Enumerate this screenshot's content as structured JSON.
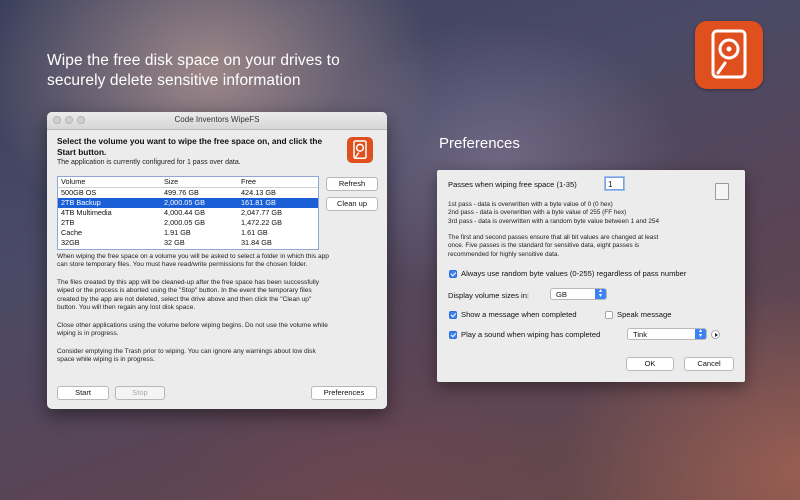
{
  "headline": {
    "line1": "Wipe the free disk space on your drives to",
    "line2": "securely delete sensitive information"
  },
  "app_icon": {
    "icon": "hard-drive-eraser-icon",
    "color": "#e0501f"
  },
  "window": {
    "title": "Code Inventors WipeFS",
    "instruction_line1": "Select the volume you want to wipe the free space on, and click the",
    "instruction_line2": "Start button.",
    "config_text": "The application is currently configured for 1 pass over data.",
    "table": {
      "headers": {
        "volume": "Volume",
        "size": "Size",
        "free": "Free"
      },
      "rows": [
        {
          "volume": "500GB OS",
          "size": "499.76 GB",
          "free": "424.13 GB"
        },
        {
          "volume": "2TB Backup",
          "size": "2,000.05 GB",
          "free": "161.81 GB"
        },
        {
          "volume": "4TB Multimedia",
          "size": "4,000.44 GB",
          "free": "2,047.77 GB"
        },
        {
          "volume": "2TB",
          "size": "2,000.05 GB",
          "free": "1,472.22 GB"
        },
        {
          "volume": "Cache",
          "size": "1.91 GB",
          "free": "1.61 GB"
        },
        {
          "volume": "32GB",
          "size": "32 GB",
          "free": "31.84 GB"
        }
      ],
      "selected_index": 1,
      "selection_color": "#1a5fd6"
    },
    "buttons": {
      "refresh": "Refresh",
      "cleanup": "Clean up",
      "start": "Start",
      "stop": "Stop",
      "preferences": "Preferences"
    },
    "para1_l1": "When wiping the free space on a volume you will be asked to select a folder in which this app",
    "para1_l2": "can store temporary files. You must have read/write permissions for the chosen folder.",
    "para2_l1": "The files created by this app will be cleaned-up after the free space has been successfully",
    "para2_l2": "wiped or the process is aborted using the \"Stop\" button. In the event the temporary files",
    "para2_l3": "created by the app are not deleted, select the drive above and then click  the \"Clean up\"",
    "para2_l4": "button. You will then regain any lost disk space.",
    "para3_l1": "Close other applications using the volume before wiping begins. Do not use the volume while",
    "para3_l2": "wiping is in progress.",
    "para4_l1": "Consider emptying the Trash prior to wiping. You can ignore any warnings about low disk",
    "para4_l2": "space while wiping is in progress."
  },
  "preferences": {
    "heading": "Preferences",
    "passes_label": "Passes when wiping free space (1-35)",
    "passes_value": "1",
    "pass1": "1st pass - data is overwritten with a byte value of 0 (0 hex)",
    "pass2": "2nd pass - data is overwritten with a byte value of 255 (FF hex)",
    "pass3": "3rd pass - data is overwritten with a random byte value between 1 and 254",
    "note_l1": "The first and second passes ensure that all bit values are changed at least",
    "note_l2": "once. Five passes is the standard for sensitive data, eight passes is",
    "note_l3": "recommended for highly sensitive data.",
    "random_label": "Always use random byte values (0-255) regardless of pass number",
    "random_checked": true,
    "display_label": "Display volume sizes in:",
    "display_value": "GB",
    "show_message_label": "Show a message when completed",
    "show_message_checked": true,
    "speak_label": "Speak message",
    "speak_checked": false,
    "play_sound_label": "Play a sound when wiping has completed",
    "play_sound_checked": true,
    "sound_value": "Tink",
    "ok": "OK",
    "cancel": "Cancel"
  }
}
